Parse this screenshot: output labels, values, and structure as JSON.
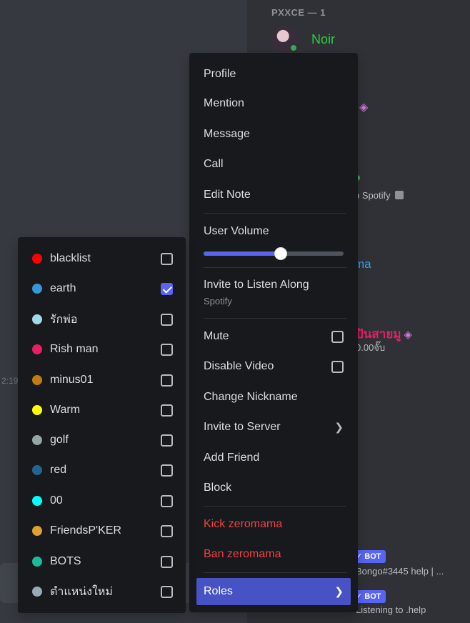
{
  "background": {
    "timestamp_fragment": "2:19",
    "member_group_header": "PXXCE — 1",
    "member_name": "Noir",
    "spotify_fragment": "o Spotify",
    "name_fragment_ma": "ma",
    "name_fragment_thai": "ปันสายมู",
    "sub_fragment": "0.00จั๊บ",
    "bot_badge_1": "✓ BOT",
    "bongo_fragment": "Bongo#3445 help | ...",
    "bot_badge_2": "✓ BOT",
    "listening_fragment": "Listening to .help"
  },
  "context_menu": {
    "profile": "Profile",
    "mention": "Mention",
    "message": "Message",
    "call": "Call",
    "edit_note": "Edit Note",
    "user_volume": "User Volume",
    "user_volume_value": 0.55,
    "invite_listen_along": "Invite to Listen Along",
    "invite_listen_along_sub": "Spotify",
    "mute": "Mute",
    "disable_video": "Disable Video",
    "change_nickname": "Change Nickname",
    "invite_to_server": "Invite to Server",
    "add_friend": "Add Friend",
    "block": "Block",
    "kick": "Kick zeromama",
    "ban": "Ban zeromama",
    "roles": "Roles",
    "icons": {
      "submenu": "chevron-right-icon",
      "checkbox": "checkbox-icon"
    }
  },
  "roles": [
    {
      "name": "blacklist",
      "color": "#ff0000",
      "checked": false
    },
    {
      "name": "earth",
      "color": "#3498db",
      "checked": true
    },
    {
      "name": "รักพ่อ",
      "color": "#a5d8e6",
      "checked": false
    },
    {
      "name": "Rish man",
      "color": "#e91e63",
      "checked": false
    },
    {
      "name": "minus01",
      "color": "#c27c0e",
      "checked": false
    },
    {
      "name": "Warm",
      "color": "#ffff00",
      "checked": false
    },
    {
      "name": "golf",
      "color": "#95a5a6",
      "checked": false
    },
    {
      "name": "red",
      "color": "#206694",
      "checked": false
    },
    {
      "name": "00",
      "color": "#00ffff",
      "checked": false
    },
    {
      "name": "FriendsP'KER",
      "color": "#e0a030",
      "checked": false
    },
    {
      "name": "BOTS",
      "color": "#1abc9c",
      "checked": false
    },
    {
      "name": "ตำแหน่งใหม่",
      "color": "#99aab5",
      "checked": false
    }
  ]
}
